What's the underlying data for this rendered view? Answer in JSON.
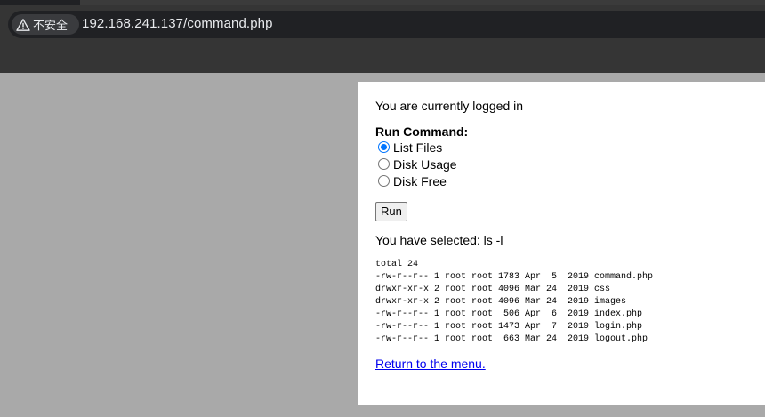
{
  "browser": {
    "security_label": "不安全",
    "url": "192.168.241.137/command.php"
  },
  "page": {
    "logged_in_message": "You are currently logged in",
    "run_command_label": "Run Command:",
    "options": [
      {
        "label": "List Files",
        "checked": true
      },
      {
        "label": "Disk Usage",
        "checked": false
      },
      {
        "label": "Disk Free",
        "checked": false
      }
    ],
    "run_button_label": "Run",
    "selected_message": "You have selected: ls -l",
    "listing": [
      "total 24",
      "-rw-r--r-- 1 root root 1783 Apr  5  2019 command.php",
      "drwxr-xr-x 2 root root 4096 Mar 24  2019 css",
      "drwxr-xr-x 2 root root 4096 Mar 24  2019 images",
      "-rw-r--r-- 1 root root  506 Apr  6  2019 index.php",
      "-rw-r--r-- 1 root root 1473 Apr  7  2019 login.php",
      "-rw-r--r-- 1 root root  663 Mar 24  2019 logout.php"
    ],
    "return_link_label": "Return to the menu."
  },
  "colors": {
    "browser_chrome": "#353535",
    "page_background": "#a9a9a9",
    "link": "#0000ee",
    "radio_accent": "#0075ff"
  }
}
